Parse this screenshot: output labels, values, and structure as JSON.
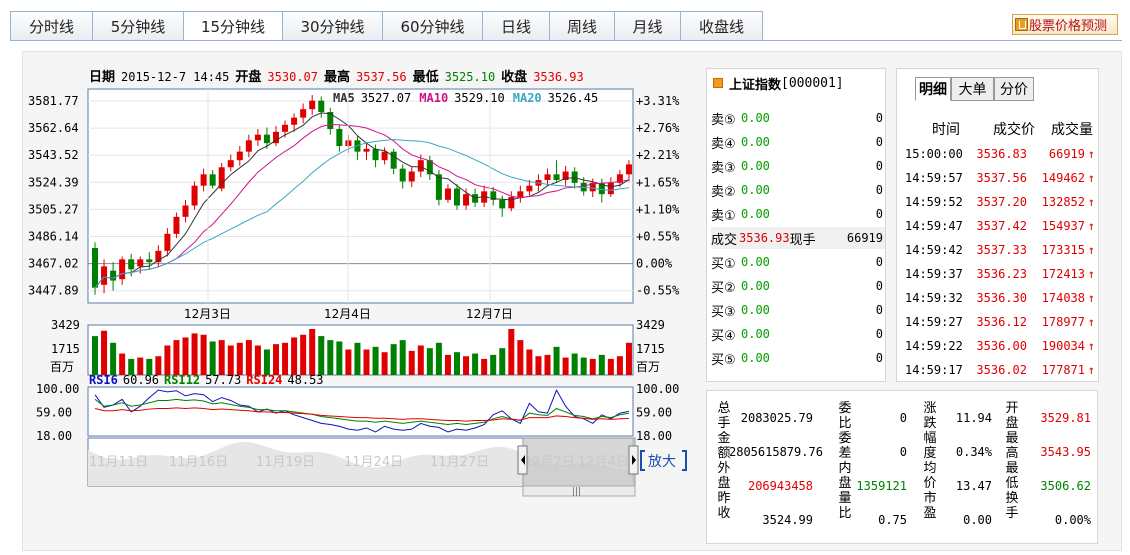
{
  "tabs": [
    "分时线",
    "5分钟线",
    "15分钟线",
    "30分钟线",
    "60分钟线",
    "日线",
    "周线",
    "月线",
    "收盘线"
  ],
  "active_tab": "15分钟线",
  "predict_button": "股票价格预测",
  "header": {
    "date_label": "日期",
    "date": "2015-12-7 14:45",
    "open_label": "开盘",
    "open": "3530.07",
    "high_label": "最高",
    "high": "3537.56",
    "low_label": "最低",
    "low": "3525.10",
    "close_label": "收盘",
    "close": "3536.93"
  },
  "ma_legend": {
    "ma5_label": "MA5",
    "ma5": "3527.07",
    "ma10_label": "MA10",
    "ma10": "3529.10",
    "ma20_label": "MA20",
    "ma20": "3526.45"
  },
  "price_axis": {
    "left": [
      "3581.77",
      "3562.64",
      "3543.52",
      "3524.39",
      "3505.27",
      "3486.14",
      "3467.02",
      "3447.89"
    ],
    "right": [
      "+3.31%",
      "+2.76%",
      "+2.21%",
      "+1.65%",
      "+1.10%",
      "+0.55%",
      "0.00%",
      "-0.55%"
    ]
  },
  "date_labels": [
    "12月3日",
    "12月4日",
    "12月7日"
  ],
  "volume_axis": {
    "top": "3429",
    "mid": "1715",
    "unit": "百万"
  },
  "rsi": {
    "rsi6_label": "RSI6",
    "rsi6": "60.96",
    "rsi12_label": "RSI12",
    "rsi12": "57.73",
    "rsi24_label": "RSI24",
    "rsi24": "48.53",
    "ticks": [
      "100.00",
      "59.00",
      "18.00"
    ]
  },
  "navigator": {
    "labels": [
      "11月11日",
      "11月16日",
      "11月19日",
      "11月24日",
      "11月27日",
      "12月2日",
      "12月4日"
    ],
    "zoom": "放大",
    "grip": "|||"
  },
  "colors": {
    "up": "#e00000",
    "down": "#008000",
    "ma5": "#333333",
    "ma10": "#d0108a",
    "ma20": "#39a7c4",
    "rsi6": "#1010c0",
    "rsi12": "#008000",
    "rsi24": "#e00000"
  },
  "ticker": {
    "title": "上证指数",
    "code": "[000001]",
    "asks": [
      {
        "label": "卖⑤",
        "price": "0.00",
        "vol": "0"
      },
      {
        "label": "卖④",
        "price": "0.00",
        "vol": "0"
      },
      {
        "label": "卖③",
        "price": "0.00",
        "vol": "0"
      },
      {
        "label": "卖②",
        "price": "0.00",
        "vol": "0"
      },
      {
        "label": "卖①",
        "price": "0.00",
        "vol": "0"
      }
    ],
    "trade": {
      "label": "成交",
      "price": "3536.93",
      "now_label": "现手",
      "now": "66919"
    },
    "bids": [
      {
        "label": "买①",
        "price": "0.00",
        "vol": "0"
      },
      {
        "label": "买②",
        "price": "0.00",
        "vol": "0"
      },
      {
        "label": "买③",
        "price": "0.00",
        "vol": "0"
      },
      {
        "label": "买④",
        "price": "0.00",
        "vol": "0"
      },
      {
        "label": "买⑤",
        "price": "0.00",
        "vol": "0"
      }
    ]
  },
  "ticks": {
    "tabs": [
      "明细",
      "大单",
      "分价"
    ],
    "active": "明细",
    "headers": [
      "时间",
      "成交价",
      "成交量"
    ],
    "rows": [
      {
        "time": "15:00:00",
        "price": "3536.83",
        "vol": "66919"
      },
      {
        "time": "14:59:57",
        "price": "3537.56",
        "vol": "149462"
      },
      {
        "time": "14:59:52",
        "price": "3537.20",
        "vol": "132852"
      },
      {
        "time": "14:59:47",
        "price": "3537.42",
        "vol": "154937"
      },
      {
        "time": "14:59:42",
        "price": "3537.33",
        "vol": "173315"
      },
      {
        "time": "14:59:37",
        "price": "3536.23",
        "vol": "172413"
      },
      {
        "time": "14:59:32",
        "price": "3536.30",
        "vol": "174038"
      },
      {
        "time": "14:59:27",
        "price": "3536.12",
        "vol": "178977"
      },
      {
        "time": "14:59:22",
        "price": "3536.00",
        "vol": "190034"
      },
      {
        "time": "14:59:17",
        "price": "3536.02",
        "vol": "177871"
      }
    ],
    "arrow": "↑"
  },
  "stats": {
    "col1_labels": "总手金额外盘昨收",
    "col1_values": [
      "2083025.79",
      "2805615879.76",
      "206943458",
      "3524.99"
    ],
    "col2_labels": "委比委差内盘量比",
    "col2_values": [
      "0",
      "0",
      "1359121",
      "0.75"
    ],
    "col3_labels": "涨跌幅度均价市盈",
    "col3_values": [
      "11.94",
      "0.34%",
      "13.47",
      "0.00"
    ],
    "col4_labels": "开盘最高最低换手",
    "col4_values": [
      "3529.81",
      "3543.95",
      "3506.62",
      "0.00%"
    ]
  }
}
